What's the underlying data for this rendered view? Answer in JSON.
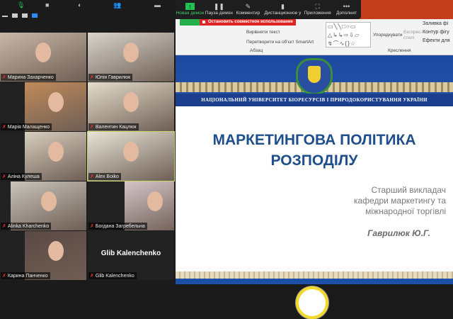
{
  "zoom_top": {
    "mic": "microphone-icon",
    "video": "video-icon",
    "security": "shield-icon",
    "participants": "participants-icon",
    "chat": "chat-icon"
  },
  "participants": [
    {
      "name": "Марина Захарченко"
    },
    {
      "name": "Юлія Гаврилюк"
    },
    {
      "name": "Марія Малащенко"
    },
    {
      "name": "Валентин Кацлюк"
    },
    {
      "name": "Аліна Кулеша"
    },
    {
      "name": "Alex Boiko"
    },
    {
      "name": "Alinka Kharchenko"
    },
    {
      "name": "Богдана Загребельна"
    },
    {
      "name": "Карина Панченко"
    },
    {
      "name": "Glib Kalenchenko",
      "big": "Glib Kalenchenko"
    }
  ],
  "share_toolbar": {
    "new_share": "Новая демон",
    "pause": "Пауза демон",
    "annotate": "Комментир",
    "remote": "Дистанционное у",
    "apps": "Приложения",
    "more": "Дополнит",
    "stop": "Остановить совместное использование"
  },
  "ribbon": {
    "align_text": "Вирівняти текст",
    "smartart": "Перетворити на об'єкт SmartArt",
    "paragraph": "Абзац",
    "arrange": "Упорядкувати",
    "styles": "Експрес-стилі",
    "fill": "Заливка фі",
    "outline": "Контур фігу",
    "effects": "Ефекти для",
    "drawing": "Креслення"
  },
  "slide": {
    "university": "НАЦІОНАЛЬНИЙ УНІВЕРСИТЕТ БІОРЕСУРСІВ І ПРИРОДОКОРИСТУВАННЯ УКРАЇНИ",
    "title1": "МАРКЕТИНГОВА ПОЛІТИКА",
    "title2": "РОЗПОДІЛУ",
    "sub1": "Старший викладач",
    "sub2": "кафедри маркетингу та",
    "sub3": "міжнародної торгівлі",
    "author": "Гаврилюк Ю.Г."
  }
}
